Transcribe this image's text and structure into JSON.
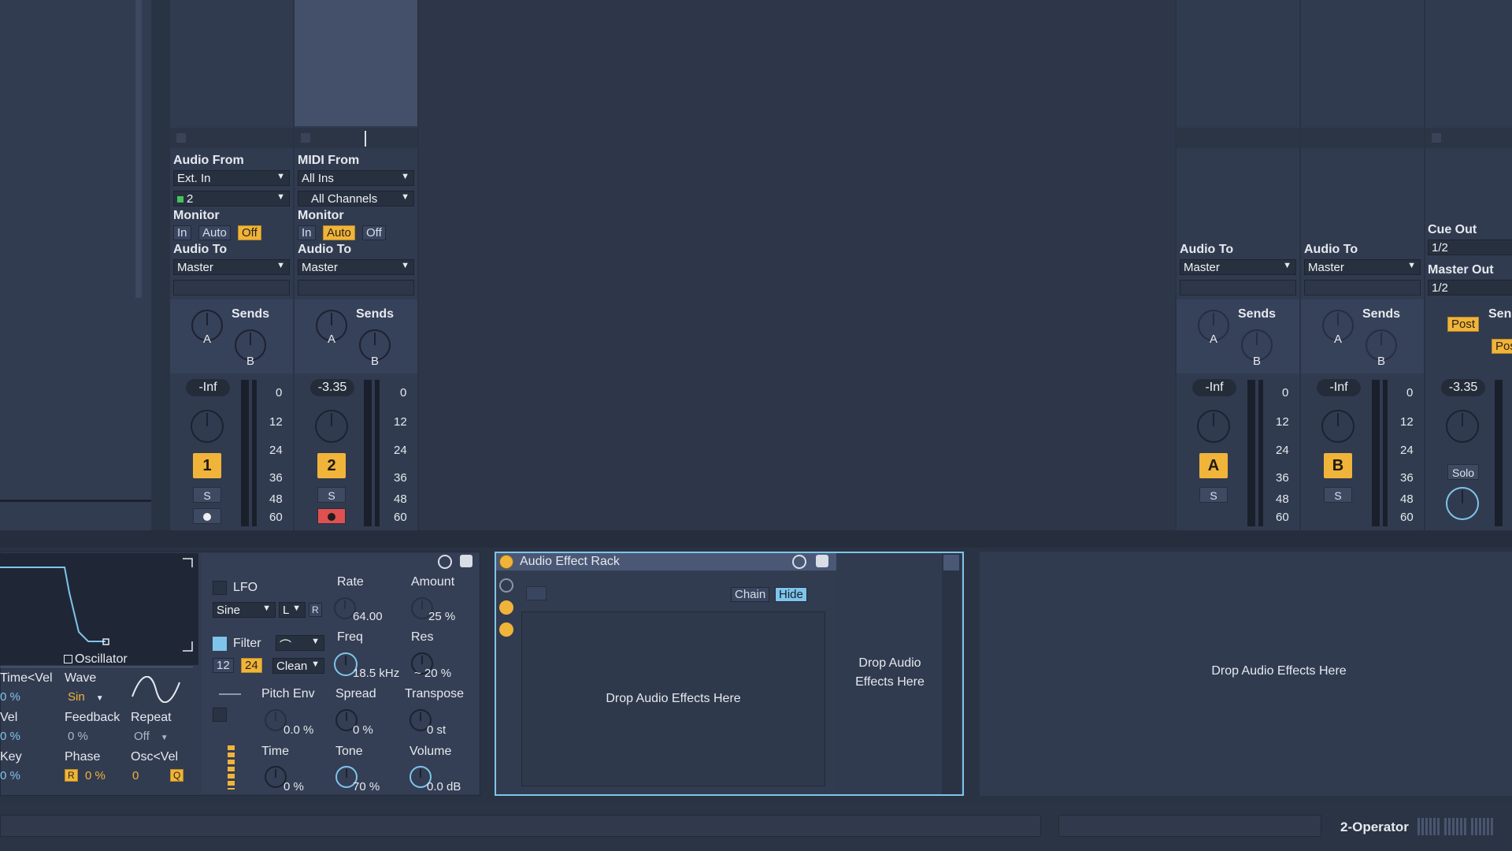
{
  "tracks": [
    {
      "input_type_label": "Audio From",
      "input_source": "Ext. In",
      "input_channel": "2",
      "monitor_label": "Monitor",
      "monitor_buttons": [
        "In",
        "Auto",
        "Off"
      ],
      "monitor_active": "Off",
      "output_label": "Audio To",
      "output_target": "Master",
      "sends_label": "Sends",
      "send_a": "A",
      "send_b": "B",
      "volume": "-Inf",
      "number": "1",
      "solo": "S",
      "arm_state": "off"
    },
    {
      "input_type_label": "MIDI From",
      "input_source": "All Ins",
      "input_channel": "All Channels",
      "monitor_label": "Monitor",
      "monitor_buttons": [
        "In",
        "Auto",
        "Off"
      ],
      "monitor_active": "Auto",
      "output_label": "Audio To",
      "output_target": "Master",
      "sends_label": "Sends",
      "send_a": "A",
      "send_b": "B",
      "volume": "-3.35",
      "number": "2",
      "solo": "S",
      "arm_state": "on"
    }
  ],
  "returns": [
    {
      "output_label": "Audio To",
      "output_target": "Master",
      "sends_label": "Sends",
      "send_a": "A",
      "send_b": "B",
      "volume": "-Inf",
      "letter": "A",
      "solo": "S"
    },
    {
      "output_label": "Audio To",
      "output_target": "Master",
      "sends_label": "Sends",
      "send_a": "A",
      "send_b": "B",
      "volume": "-Inf",
      "letter": "B",
      "solo": "S"
    }
  ],
  "master": {
    "cue_out_label": "Cue Out",
    "cue_out_value": "1/2",
    "master_out_label": "Master Out",
    "master_out_value": "1/2",
    "post_label": "Post",
    "post_label_2": "Pos",
    "sends_label": "Sen",
    "volume": "-3.35",
    "solo_label": "Solo"
  },
  "meter_scale": [
    "0",
    "12",
    "24",
    "36",
    "48",
    "60"
  ],
  "operator": {
    "oscillator_label": "Oscillator",
    "rows": [
      {
        "label": "Time<Vel",
        "value": "0 %"
      },
      {
        "label": "Vel",
        "value": "0 %"
      },
      {
        "label": "Key",
        "value": "0 %"
      }
    ],
    "wave_label": "Wave",
    "wave_value": "Sin",
    "feedback_label": "Feedback",
    "feedback_value": "0 %",
    "repeat_label": "Repeat",
    "repeat_value": "Off",
    "phase_label": "Phase",
    "phase_r": "R",
    "phase_value": "0 %",
    "oscvel_label": "Osc<Vel",
    "oscvel_value": "0",
    "oscvel_q": "Q",
    "lfo_label": "LFO",
    "lfo_wave": "Sine",
    "lfo_lr": "L",
    "lfo_r": "R",
    "rate_label": "Rate",
    "rate_value": "64.00",
    "amount_label": "Amount",
    "amount_value": "25 %",
    "filter_label": "Filter",
    "filter_12": "12",
    "filter_24": "24",
    "filter_mode": "Clean",
    "freq_label": "Freq",
    "freq_value": "18.5 kHz",
    "res_label": "Res",
    "res_value": "~ 20 %",
    "pitchenv_label": "Pitch Env",
    "pitchenv_value": "0.0 %",
    "spread_label": "Spread",
    "spread_value": "0 %",
    "transpose_label": "Transpose",
    "transpose_value": "0 st",
    "time_label": "Time",
    "time_value": "0 %",
    "tone_label": "Tone",
    "tone_value": "70 %",
    "volume_label": "Volume",
    "volume_value": "0.0 dB"
  },
  "rack": {
    "title": "Audio Effect Rack",
    "chain_label": "Chain",
    "hide_label": "Hide",
    "drop_main": "Drop Audio Effects Here",
    "drop_side_line1": "Drop Audio",
    "drop_side_line2": "Effects Here",
    "drop_right": "Drop Audio Effects Here"
  },
  "status": {
    "device_name": "2-Operator"
  },
  "colors": {
    "accent": "#f0b43a",
    "selected_blue": "#7fc4ea",
    "arm_red": "#e05050",
    "background": "#2a3344"
  }
}
